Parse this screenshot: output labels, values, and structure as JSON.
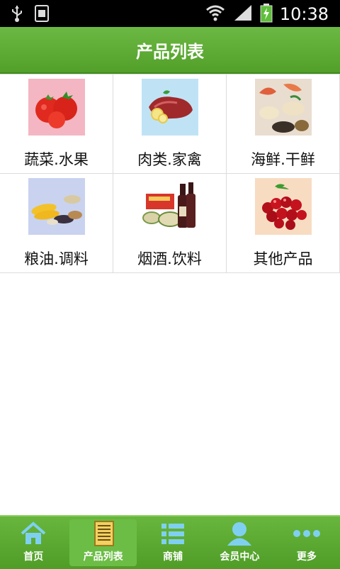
{
  "status_bar": {
    "time": "10:38",
    "icons": [
      "usb-icon",
      "sim-icon",
      "wifi-icon",
      "signal-icon",
      "battery-charging-icon"
    ]
  },
  "header": {
    "title": "产品列表"
  },
  "categories": [
    {
      "label": "蔬菜.水果",
      "icon": "tomato-image",
      "bg": "#f4b6c2"
    },
    {
      "label": "肉类.家禽",
      "icon": "meat-image",
      "bg": "#bfe3f5"
    },
    {
      "label": "海鲜.干鲜",
      "icon": "seafood-image",
      "bg": "#ffffff"
    },
    {
      "label": "粮油.调料",
      "icon": "grain-image",
      "bg": "#c9d3f0"
    },
    {
      "label": "烟酒.饮料",
      "icon": "wine-tea-image",
      "bg": "#ffffff"
    },
    {
      "label": "其他产品",
      "icon": "cherry-image",
      "bg": "#f8dcc2"
    }
  ],
  "tab_bar": {
    "tabs": [
      {
        "label": "首页",
        "icon": "home-icon"
      },
      {
        "label": "产品列表",
        "icon": "document-list-icon",
        "active": true
      },
      {
        "label": "商铺",
        "icon": "list-icon"
      },
      {
        "label": "会员中心",
        "icon": "user-icon"
      },
      {
        "label": "更多",
        "icon": "more-dots-icon"
      }
    ]
  },
  "colors": {
    "header_green": "#5aa833",
    "tab_green": "#5aa933",
    "icon_blue": "#7fd0f0"
  }
}
